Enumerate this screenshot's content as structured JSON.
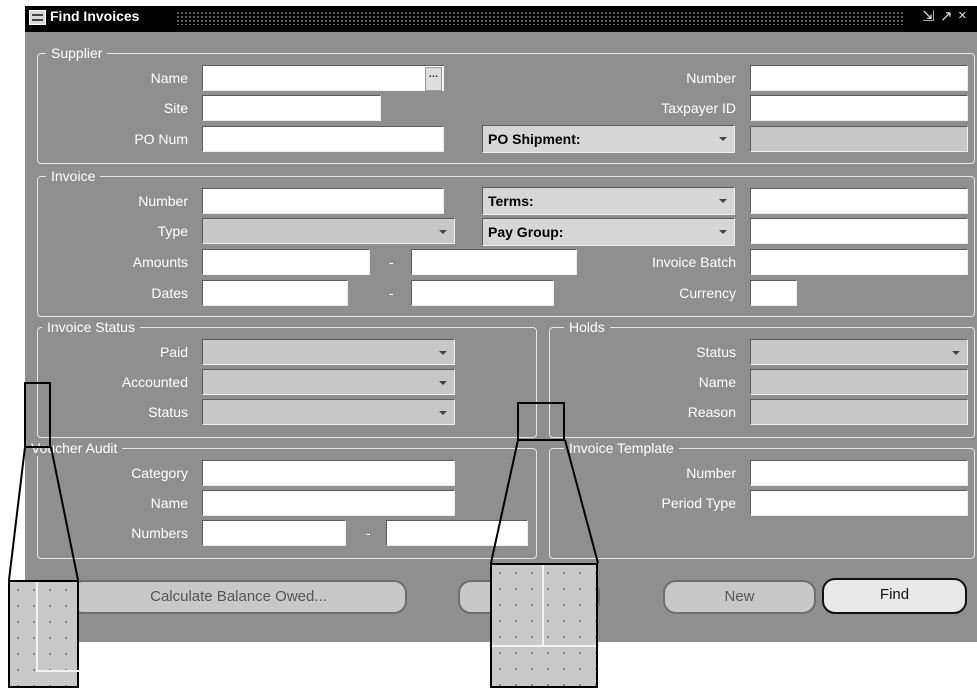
{
  "window": {
    "title": "Find Invoices",
    "controls": [
      "⇲",
      "↗",
      "×"
    ]
  },
  "supplier": {
    "legend": "Supplier",
    "name_label": "Name",
    "name_value": "",
    "site_label": "Site",
    "site_value": "",
    "po_num_label": "PO Num",
    "po_num_value": "",
    "po_shipment_label": "PO Shipment:",
    "number_label": "Number",
    "number_value": "",
    "taxpayer_label": "Taxpayer ID",
    "taxpayer_value": "",
    "lov_icon": "ellipsis-icon",
    "lov_glyph": "…"
  },
  "invoice": {
    "legend": "Invoice",
    "number_label": "Number",
    "type_label": "Type",
    "amounts_label": "Amounts",
    "dates_label": "Dates",
    "range_sep": "-",
    "terms_label": "Terms:",
    "pay_group_label": "Pay Group:",
    "batch_label": "Invoice Batch",
    "currency_label": "Currency"
  },
  "invoice_status": {
    "legend": "Invoice Status",
    "paid_label": "Paid",
    "accounted_label": "Accounted",
    "status_label": "Status"
  },
  "holds": {
    "legend": "Holds",
    "status_label": "Status",
    "name_label": "Name",
    "reason_label": "Reason"
  },
  "voucher_audit": {
    "legend": "Voucher Audit",
    "category_label": "Category",
    "name_label": "Name",
    "numbers_label": "Numbers",
    "range_sep": "-"
  },
  "invoice_template": {
    "legend": "Invoice Template",
    "number_label": "Number",
    "period_label": "Period Type"
  },
  "buttons": {
    "calculate": "Calculate Balance Owed...",
    "new": "New",
    "find": "Find"
  },
  "colors": {
    "window_bg": "#8f8f8f",
    "title_bar": "#000000",
    "field_bg": "#ffffff",
    "disabled_field": "#c7c7c7"
  }
}
